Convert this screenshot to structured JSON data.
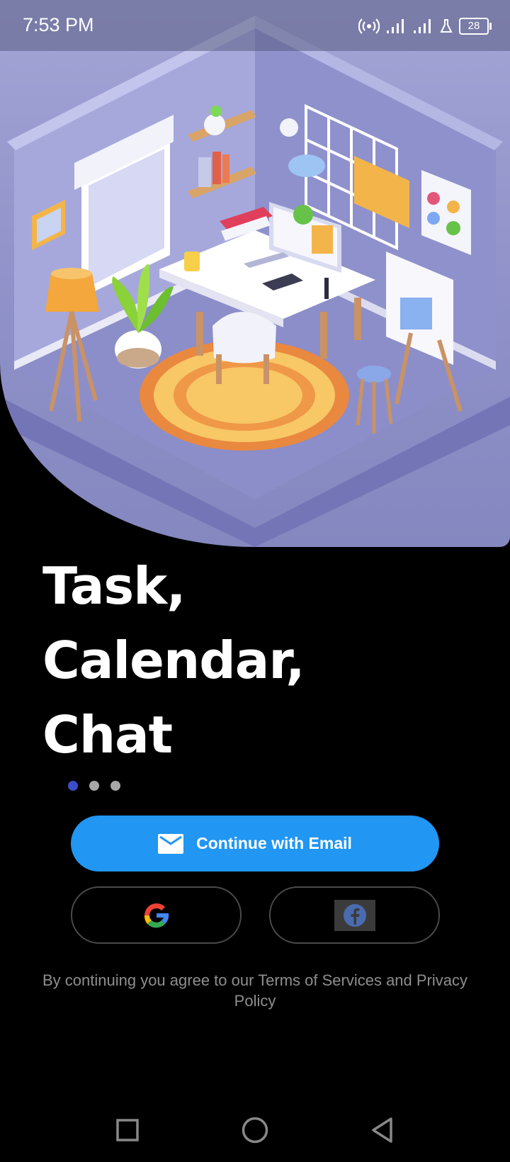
{
  "status_bar": {
    "time": "7:53 PM",
    "battery": "28",
    "icons": [
      "hotspot-icon",
      "signal-icon",
      "signal-icon",
      "flask-icon",
      "battery-icon"
    ]
  },
  "hero": {
    "illustration": "isometric-workspace-room-illustration",
    "colors": {
      "wall": "#9ea0d4",
      "floor": "#8d8fc6",
      "rug": "#f5b35c",
      "desk": "#ffffff"
    }
  },
  "headline": {
    "line1": "Task,",
    "line2": "Calendar,",
    "line3": "Chat"
  },
  "pager": {
    "count": 3,
    "active_index": 0
  },
  "actions": {
    "email_label": "Continue with Email",
    "google_icon": "google-icon",
    "facebook_icon": "facebook-icon"
  },
  "terms": "By continuing you agree to our Terms of Services and Privacy Policy",
  "nav": {
    "recent_icon": "square-icon",
    "home_icon": "circle-icon",
    "back_icon": "triangle-back-icon"
  },
  "colors": {
    "primary": "#2196f3",
    "active_dot": "#3d4cc8",
    "background": "#000000"
  }
}
